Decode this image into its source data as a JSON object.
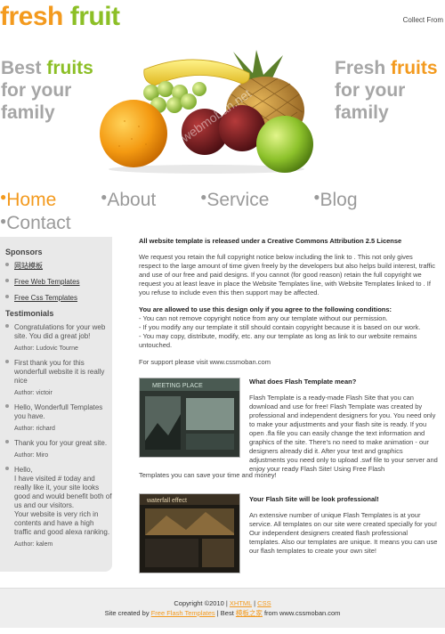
{
  "header": {
    "logo_part1": "fresh",
    "logo_part2": "fruit",
    "collect": "Collect From",
    "slogan_left": {
      "line1_a": "Best ",
      "line1_b": "fruits",
      "line2": "for your",
      "line3": "family"
    },
    "slogan_right": {
      "line1_a": "Fresh ",
      "line1_b": "fruits",
      "line2": "for your",
      "line3": "family"
    }
  },
  "nav": [
    {
      "label": "Home",
      "active": true
    },
    {
      "label": "About",
      "active": false
    },
    {
      "label": "Service",
      "active": false
    },
    {
      "label": "Blog",
      "active": false
    },
    {
      "label": "Contact",
      "active": false
    }
  ],
  "sidebar": {
    "sponsors_title": "Sponsors",
    "sponsors": [
      "网站模板",
      "Free Web Templates",
      "Free Css Templates"
    ],
    "testimonials_title": "Testimonials",
    "testimonials": [
      {
        "text": "Congratulations for your web site. You did a great job!",
        "author": "Author: Ludovic Tourne"
      },
      {
        "text": "First thank you for this wonderfull website it is really nice",
        "author": "Author: victoir"
      },
      {
        "text": "Hello, Wonderfull Templates you have.",
        "author": "Author: richard"
      },
      {
        "text": "Thank you for your great site.",
        "author": "Author: Miro"
      },
      {
        "text": "Hello,\nI have visited # today and really like it, your site looks good and would benefit both of us and our visitors.\nYour website is very rich in contents and have a high traffic and good alexa ranking.",
        "author": "Author: kalem"
      }
    ]
  },
  "main": {
    "license_title": "All website template is released under a Creative Commons Attribution 2.5 License",
    "license_p1": "We request you retain the full copyright notice below including the link to . This not only gives respect to the large amount of time given freely by the developers but also helps build interest, traffic and use of our free and paid designs. If you cannot (for good reason) retain the full copyright we request you at least leave in place the Website Templates line, with Website Templates linked to . If you refuse to include even this then support may be affected.",
    "conditions_title": "You are allowed to use this design only if you agree to the following conditions:",
    "conditions": [
      "- You can not remove copyright notice from any our template without our permission.",
      "- If you modify any our template it still should contain copyright because it is based on our work.",
      "- You may copy, distribute, modify, etc. any our template as long as link to our website remains untouched."
    ],
    "support": "For support please visit www.cssmoban.com",
    "block1_title": "What does Flash Template mean?",
    "block1_text": "Flash Template is a ready-made Flash Site that you can download and use for free! Flash Template was created by professional and independent designers for you. You need only to make your adjustments and your flash site is ready. If you open .fla file you can easily change the text information and graphics of the site. There's no need to make animation - our designers already did it. After your text and graphics adjustments you need only to upload .swf file to your server and enjoy your ready Flash Site! Using Free Flash",
    "block1_tail": "Templates you can save your time and money!",
    "block1_thumb_caption": "MEETING PLACE",
    "block2_title": "Your Flash Site will be look professional!",
    "block2_text": "An extensive number of unique Flash Templates is at your service. All templates on our site were created specially for you! Our independent designers created flash professional templates. Also our templates are unique. It means you can use our flash templates to create your own site!",
    "block2_thumb_caption": "waterfall effect"
  },
  "footer": {
    "copyright": "Copyright ©2010 | ",
    "xhtml": "XHTML",
    "sep": " | ",
    "css": "CSS",
    "created_prefix": "Site created by ",
    "created_link": "Free Flash Templates",
    "best": " | Best ",
    "best_link": "模板之家",
    "from": " from www.cssmoban.com"
  },
  "watermark": "webmoban.net"
}
